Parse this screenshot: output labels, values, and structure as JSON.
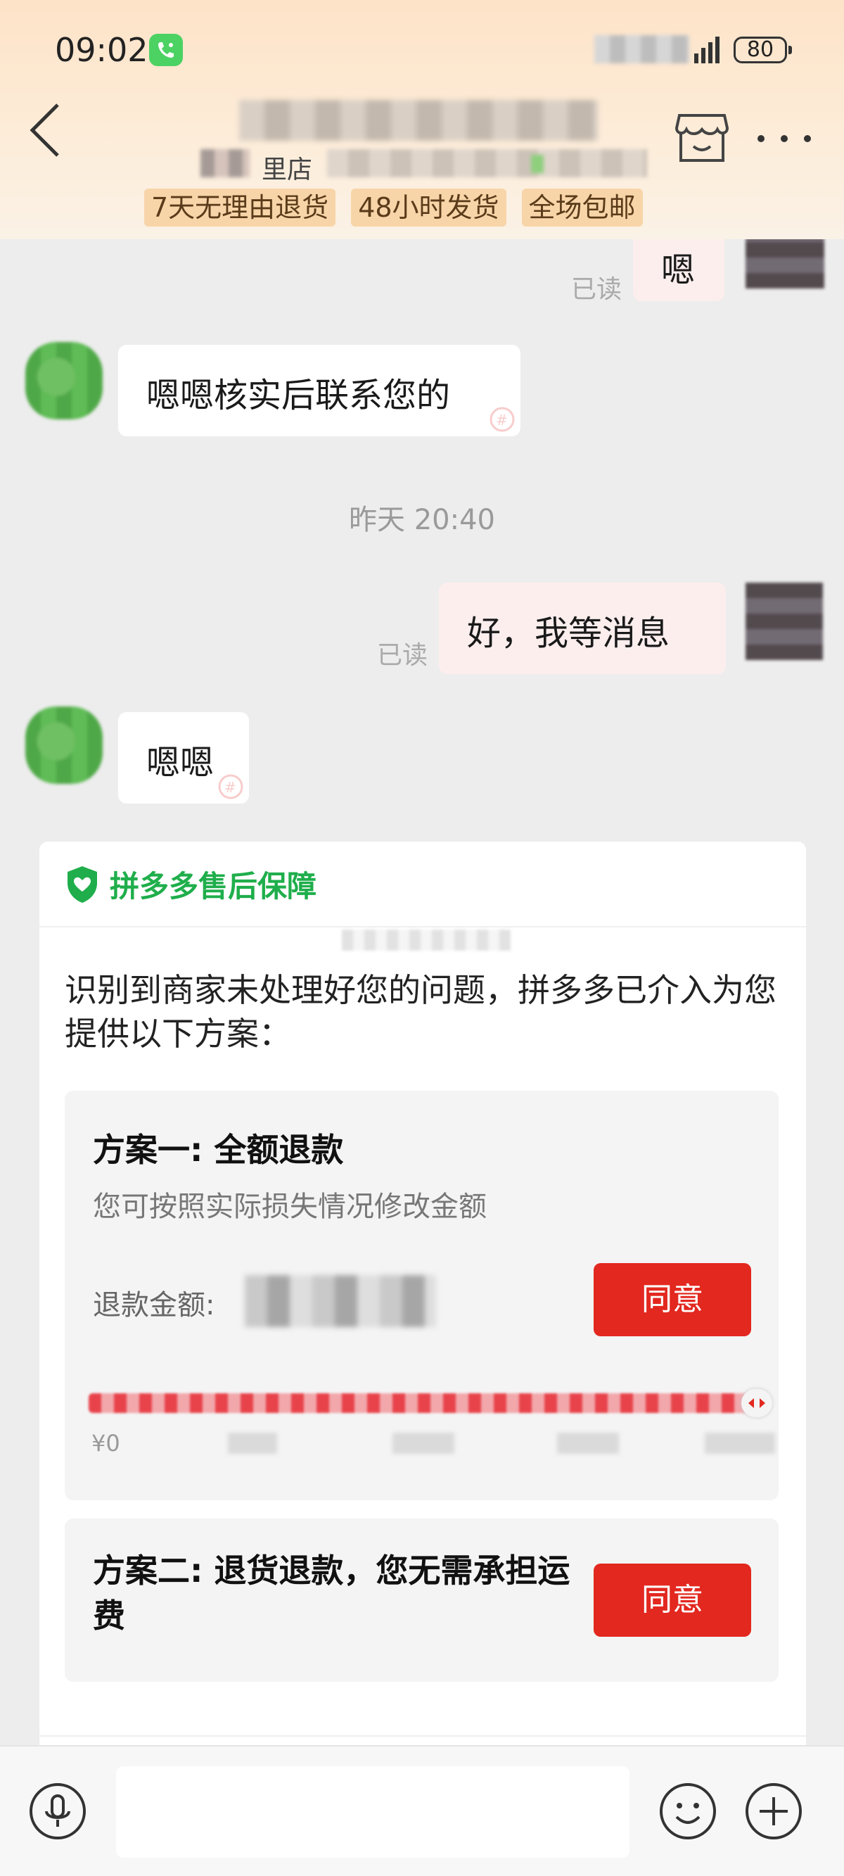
{
  "status_bar": {
    "time": "09:02",
    "battery": "80"
  },
  "header": {
    "subtitle_prefix": "里店",
    "badges": [
      "7天无理由退货",
      "48小时发货",
      "全场包邮"
    ]
  },
  "chat": {
    "read_label": "已读",
    "messages": [
      {
        "side": "mine",
        "text": "嗯"
      },
      {
        "side": "seller",
        "text": "嗯嗯核实后联系您的"
      },
      {
        "side": "mine",
        "text": "好，我等消息"
      },
      {
        "side": "seller",
        "text": "嗯嗯"
      }
    ],
    "timestamp": "昨天 20:40"
  },
  "card": {
    "brand": "拼多多售后保障",
    "intro": "识别到商家未处理好您的问题，拼多多已介入为您提供以下方案：",
    "plan1": {
      "title": "方案一: 全额退款",
      "desc": "您可按照实际损失情况修改金额",
      "amount_label": "退款金额:",
      "agree_label": "同意",
      "slider_min": "¥0",
      "slider_level": 1.0
    },
    "plan2": {
      "title": "方案二: 退货退款，您无需承担运费",
      "agree_label": "同意"
    }
  },
  "colors": {
    "accent_red": "#e2281f",
    "brand_green": "#1fae4b",
    "badge_bg": "#f8d5a8"
  },
  "icons": [
    "back-icon",
    "store-icon",
    "more-icon",
    "mic-icon",
    "emoji-icon",
    "plus-icon",
    "shield-icon",
    "call-icon",
    "signal-icon"
  ]
}
